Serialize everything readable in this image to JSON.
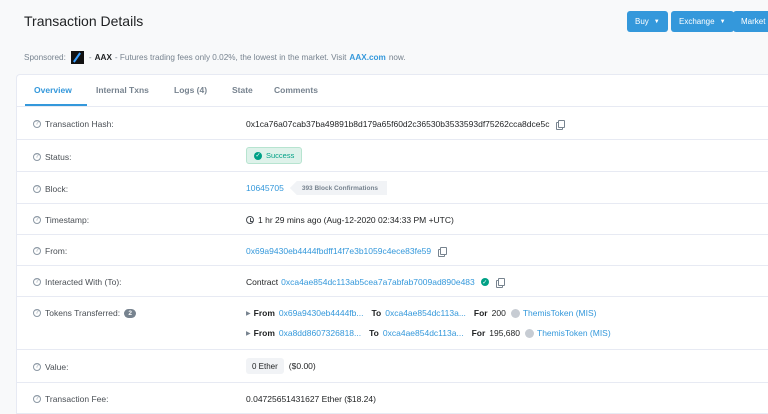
{
  "header": {
    "title": "Transaction Details",
    "buttons": [
      {
        "label": "Buy"
      },
      {
        "label": "Exchange"
      },
      {
        "label": "Market"
      }
    ]
  },
  "sponsor": {
    "prefix": "Sponsored:",
    "name": "AAX",
    "text": "- Futures trading fees only 0.02%, the lowest in the market. Visit",
    "link": "AAX.com",
    "suffix": "now."
  },
  "tabs": [
    {
      "label": "Overview"
    },
    {
      "label": "Internal Txns"
    },
    {
      "label": "Logs (4)"
    },
    {
      "label": "State"
    },
    {
      "label": "Comments"
    }
  ],
  "rows": {
    "hash": {
      "label": "Transaction Hash:",
      "value": "0x1ca76a07cab37ba49891b8d179a65f60d2c36530b3533593df75262cca8dce5c"
    },
    "status": {
      "label": "Status:",
      "value": "Success"
    },
    "block": {
      "label": "Block:",
      "value": "10645705",
      "confirmations": "393 Block Confirmations"
    },
    "timestamp": {
      "label": "Timestamp:",
      "value": "1 hr 29 mins ago (Aug-12-2020 02:34:33 PM +UTC)"
    },
    "from": {
      "label": "From:",
      "value": "0x69a9430eb4444fbdff14f7e3b1059c4ece83fe59"
    },
    "interacted": {
      "label": "Interacted With (To):",
      "prefix": "Contract",
      "value": "0xca4ae854dc113ab5cea7a7abfab7009ad890e483"
    },
    "tokens": {
      "label": "Tokens Transferred:",
      "count": "2",
      "transfers": [
        {
          "from_label": "From",
          "from": "0x69a9430eb4444fb...",
          "to_label": "To",
          "to": "0xca4ae854dc113a...",
          "for_label": "For",
          "amount": "200",
          "token": "ThemisToken (MIS)"
        },
        {
          "from_label": "From",
          "from": "0xa8dd8607326818...",
          "to_label": "To",
          "to": "0xca4ae854dc113a...",
          "for_label": "For",
          "amount": "195,680",
          "token": "ThemisToken (MIS)"
        }
      ]
    },
    "value": {
      "label": "Value:",
      "amount": "0 Ether",
      "usd": "($0.00)"
    },
    "fee": {
      "label": "Transaction Fee:",
      "value": "0.04725651431627 Ether ($18.24)"
    }
  }
}
